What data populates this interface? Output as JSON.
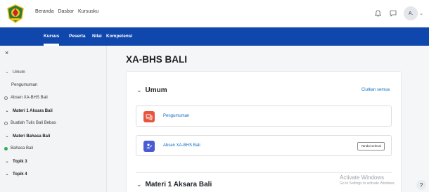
{
  "topbar": {
    "nav": [
      "Beranda",
      "Dasbor",
      "Kursusku"
    ],
    "avatar_initials": "A."
  },
  "secondary_nav": {
    "tabs": [
      "Kursus",
      "Peserta",
      "Nilai",
      "Kompetensi"
    ],
    "active_tab": "Kursus",
    "background": "#0f47ad"
  },
  "drawer": {
    "close_symbol": "×",
    "items": [
      {
        "label": "Umum",
        "kind": "section"
      },
      {
        "label": "Pengumuman",
        "kind": "activity"
      },
      {
        "label": "Absen XA-BHS Bali",
        "kind": "activity-incomplete"
      },
      {
        "label": "Materi 1 Aksara Bali",
        "kind": "section-bold"
      },
      {
        "label": "Buatlah Tulis Bali Bebas",
        "kind": "activity-incomplete"
      },
      {
        "label": "Materi Bahasa Bali",
        "kind": "section-bold"
      },
      {
        "label": "Bahasa Bali",
        "kind": "activity-complete"
      },
      {
        "label": "Topik 3",
        "kind": "section"
      },
      {
        "label": "Topik 4",
        "kind": "section"
      }
    ]
  },
  "main": {
    "course_title": "XA-BHS BALI",
    "collapse_all": "Ciutkan semua",
    "sections": [
      {
        "title": "Umum",
        "activities": [
          {
            "name": "Pengumuman",
            "icon": "forum-icon",
            "icon_color": "#e8553f"
          },
          {
            "name": "Absen XA-BHS Bali",
            "icon": "attendance-icon",
            "icon_color": "#4a5bd4",
            "button": "Tandai selesai"
          }
        ]
      },
      {
        "title": "Materi 1 Aksara Bali",
        "activities": []
      }
    ]
  },
  "watermark": {
    "line1": "Activate Windows",
    "line2": "Go to Settings to activate Windows."
  },
  "help_label": "?"
}
